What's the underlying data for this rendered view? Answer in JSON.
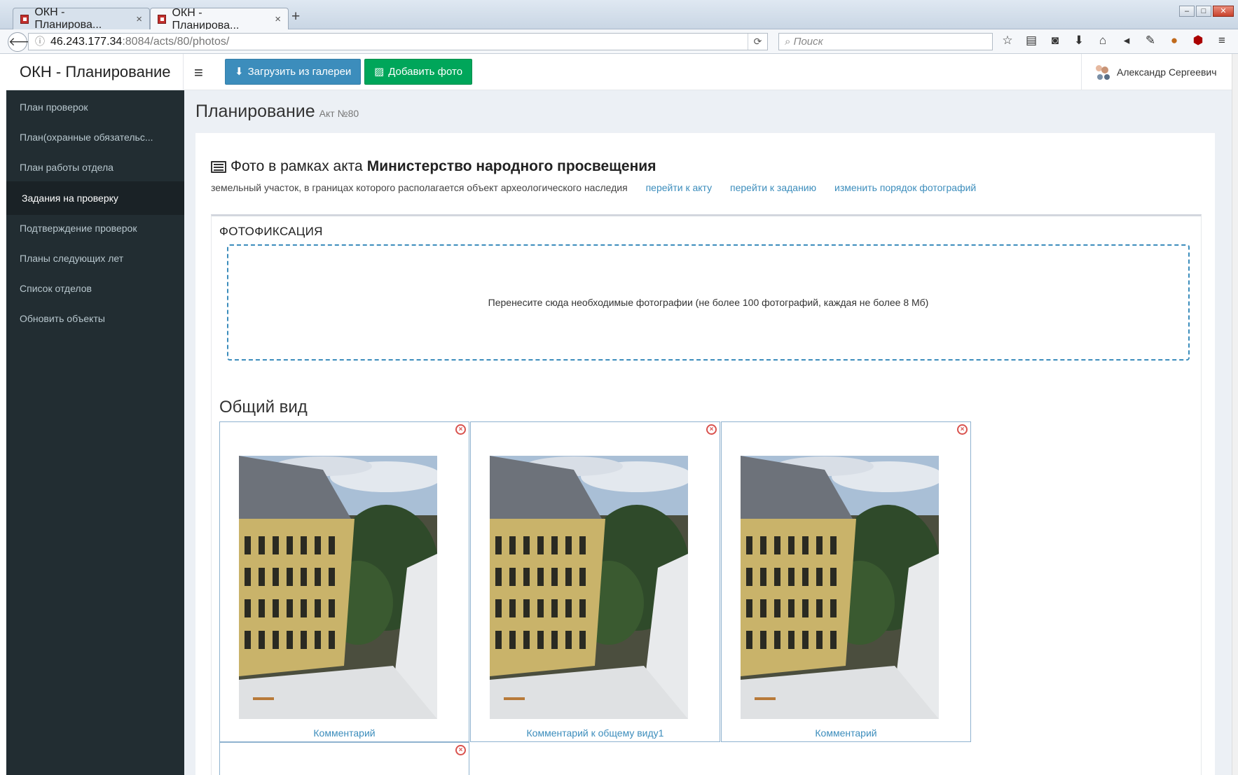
{
  "browser": {
    "tabs": [
      {
        "title": "ОКН - Планирова...",
        "close": "×"
      },
      {
        "title": "ОКН - Планирова...",
        "close": "×"
      }
    ],
    "new_tab": "+",
    "url_host": "46.243.177.34",
    "url_rest": ":8084/acts/80/photos/",
    "search_placeholder": "Поиск"
  },
  "header": {
    "brand": "ОКН - Планирование",
    "gallery_button": "Загрузить из галереи",
    "add_photo_button": "Добавить фото",
    "user_name": "Александр Сергеевич"
  },
  "sidebar": {
    "items": [
      {
        "label": "План проверок"
      },
      {
        "label": "План(охранные обязательс..."
      },
      {
        "label": "План работы отдела"
      },
      {
        "label": "Задания на проверку"
      },
      {
        "label": "Подтверждение проверок"
      },
      {
        "label": "Планы следующих лет"
      },
      {
        "label": "Список отделов"
      },
      {
        "label": "Обновить объекты"
      }
    ],
    "active_index": 3
  },
  "page": {
    "title": "Планирование",
    "subtitle": "Акт №80",
    "photos_heading_prefix": "Фото в рамках акта",
    "photos_heading_bold": "Министерство народного просвещения",
    "description": "земельный участок, в границах которого располагается объект археологического наследия",
    "links": [
      "перейти к акту",
      "перейти к заданию",
      "изменить порядок фотографий"
    ],
    "panel_title": "ФОТОФИКСАЦИЯ",
    "dropzone_text": "Перенесите сюда необходимые фотографии (не более 100 фотографий, каждая не более 8 Мб)",
    "section_title": "Общий вид",
    "photos": [
      {
        "comment": "Комментарий"
      },
      {
        "comment": "Комментарий к общему виду1"
      },
      {
        "comment": "Комментарий"
      }
    ],
    "remove_icon": "×"
  },
  "colors": {
    "sidebar_bg": "#222d32",
    "primary": "#3c8dbc",
    "success": "#00a65a",
    "danger": "#d9534f"
  }
}
